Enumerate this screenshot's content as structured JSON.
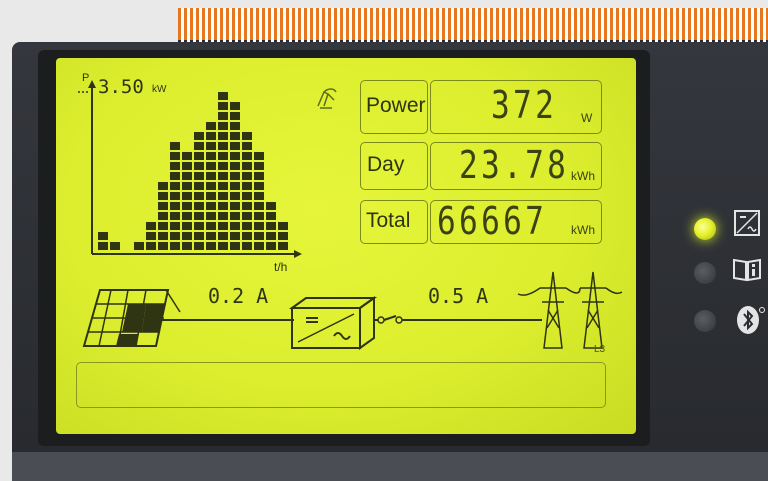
{
  "chart": {
    "y_axis_letter": "P",
    "max_power": "3.50",
    "max_power_unit": "kW",
    "x_axis_label": "t/h",
    "bar_levels": [
      2,
      1,
      0,
      1,
      3,
      7,
      11,
      10,
      12,
      13,
      16,
      15,
      12,
      10,
      5,
      3
    ]
  },
  "readouts": [
    {
      "label": "Power",
      "value": "372",
      "unit": "W"
    },
    {
      "label": "Day",
      "value": "23.78",
      "unit": "kWh"
    },
    {
      "label": "Total",
      "value": "66667",
      "unit": "kWh"
    }
  ],
  "flow": {
    "dc_current": "0.2 A",
    "ac_current": "0.5 A",
    "phase": "L3"
  },
  "indicators": {
    "operation_led": "on",
    "info_led": "off",
    "bluetooth_led": "off"
  },
  "colors": {
    "lcd_background": "#dcee2e",
    "segment_dark": "#2f3413",
    "led_green": "#e6f12a"
  }
}
